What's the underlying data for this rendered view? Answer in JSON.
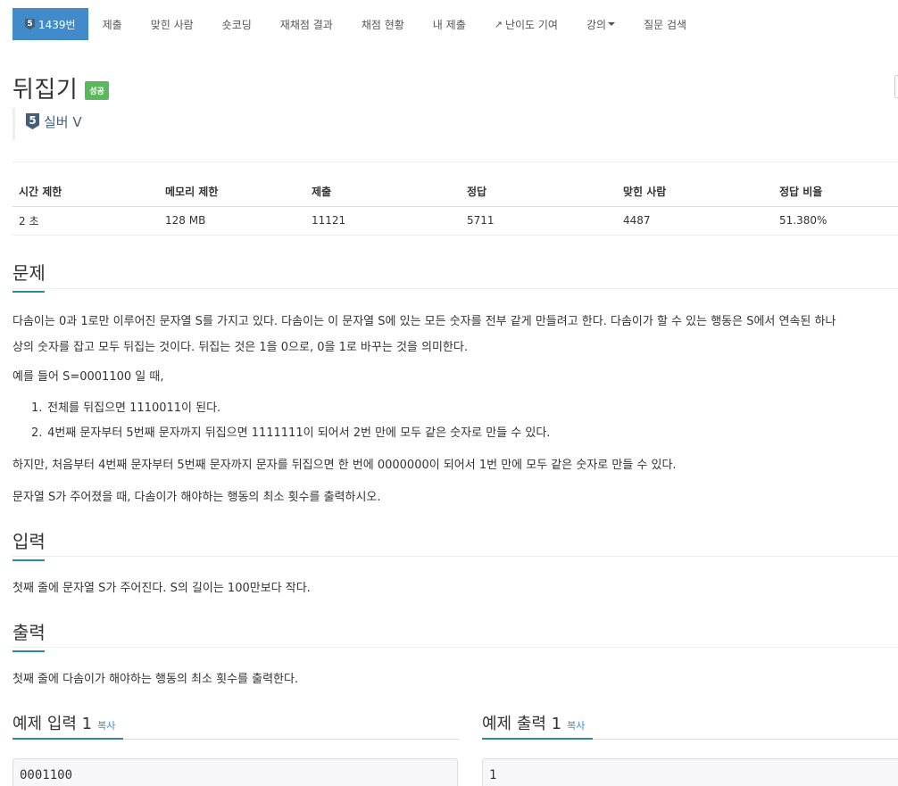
{
  "nav": {
    "problem_tier": "5",
    "problem_tab": "1439번",
    "items": [
      "제출",
      "맞힌 사람",
      "숏코딩",
      "재채점 결과",
      "채점 현황",
      "내 제출",
      "난이도 기여",
      "강의",
      "질문 검색"
    ]
  },
  "problem": {
    "title": "뒤집기",
    "status_badge": "성공",
    "tier_number": "5",
    "tier_label": "실버 V"
  },
  "stats": {
    "headers": [
      "시간 제한",
      "메모리 제한",
      "제출",
      "정답",
      "맞힌 사람",
      "정답 비율"
    ],
    "values": [
      "2 초",
      "128 MB",
      "11121",
      "5711",
      "4487",
      "51.380%"
    ]
  },
  "sections": {
    "description_title": "문제",
    "description_p1a": "다솜이는 0과 1로만 이루어진 문자열 S를 가지고 있다. 다솜이는 이 문자열 S에 있는 모든 숫자를 전부 같게 만들려고 한다. 다솜이가 할 수 있는 행동은 S에서 연속된 하나",
    "description_p1b": "상의 숫자를 잡고 모두 뒤집는 것이다. 뒤집는 것은 1을 0으로, 0을 1로 바꾸는 것을 의미한다.",
    "description_p2": "예를 들어 S=0001100 일 때,",
    "list": [
      {
        "num": "1.",
        "text": "전체를 뒤집으면 1110011이 된다."
      },
      {
        "num": "2.",
        "text": "4번째 문자부터 5번째 문자까지 뒤집으면 1111111이 되어서 2번 만에 모두 같은 숫자로 만들 수 있다."
      }
    ],
    "description_p3": "하지만, 처음부터 4번째 문자부터 5번째 문자까지 문자를 뒤집으면 한 번에 0000000이 되어서 1번 만에 모두 같은 숫자로 만들 수 있다.",
    "description_p4": "문자열 S가 주어졌을 때, 다솜이가 해야하는 행동의 최소 횟수를 출력하시오.",
    "input_title": "입력",
    "input_text": "첫째 줄에 문자열 S가 주어진다. S의 길이는 100만보다 작다.",
    "output_title": "출력",
    "output_text": "첫째 줄에 다솜이가 해야하는 행동의 최소 횟수를 출력한다."
  },
  "examples": {
    "input_title": "예제 입력 1",
    "output_title": "예제 출력 1",
    "copy_label": "복사",
    "input_value": "0001100",
    "output_value": "1"
  },
  "colors": {
    "active_tab": "#428bca",
    "badge_success": "#5cb85c",
    "tier_silver": "#435f7a",
    "section_underline": "#2e8b99"
  }
}
